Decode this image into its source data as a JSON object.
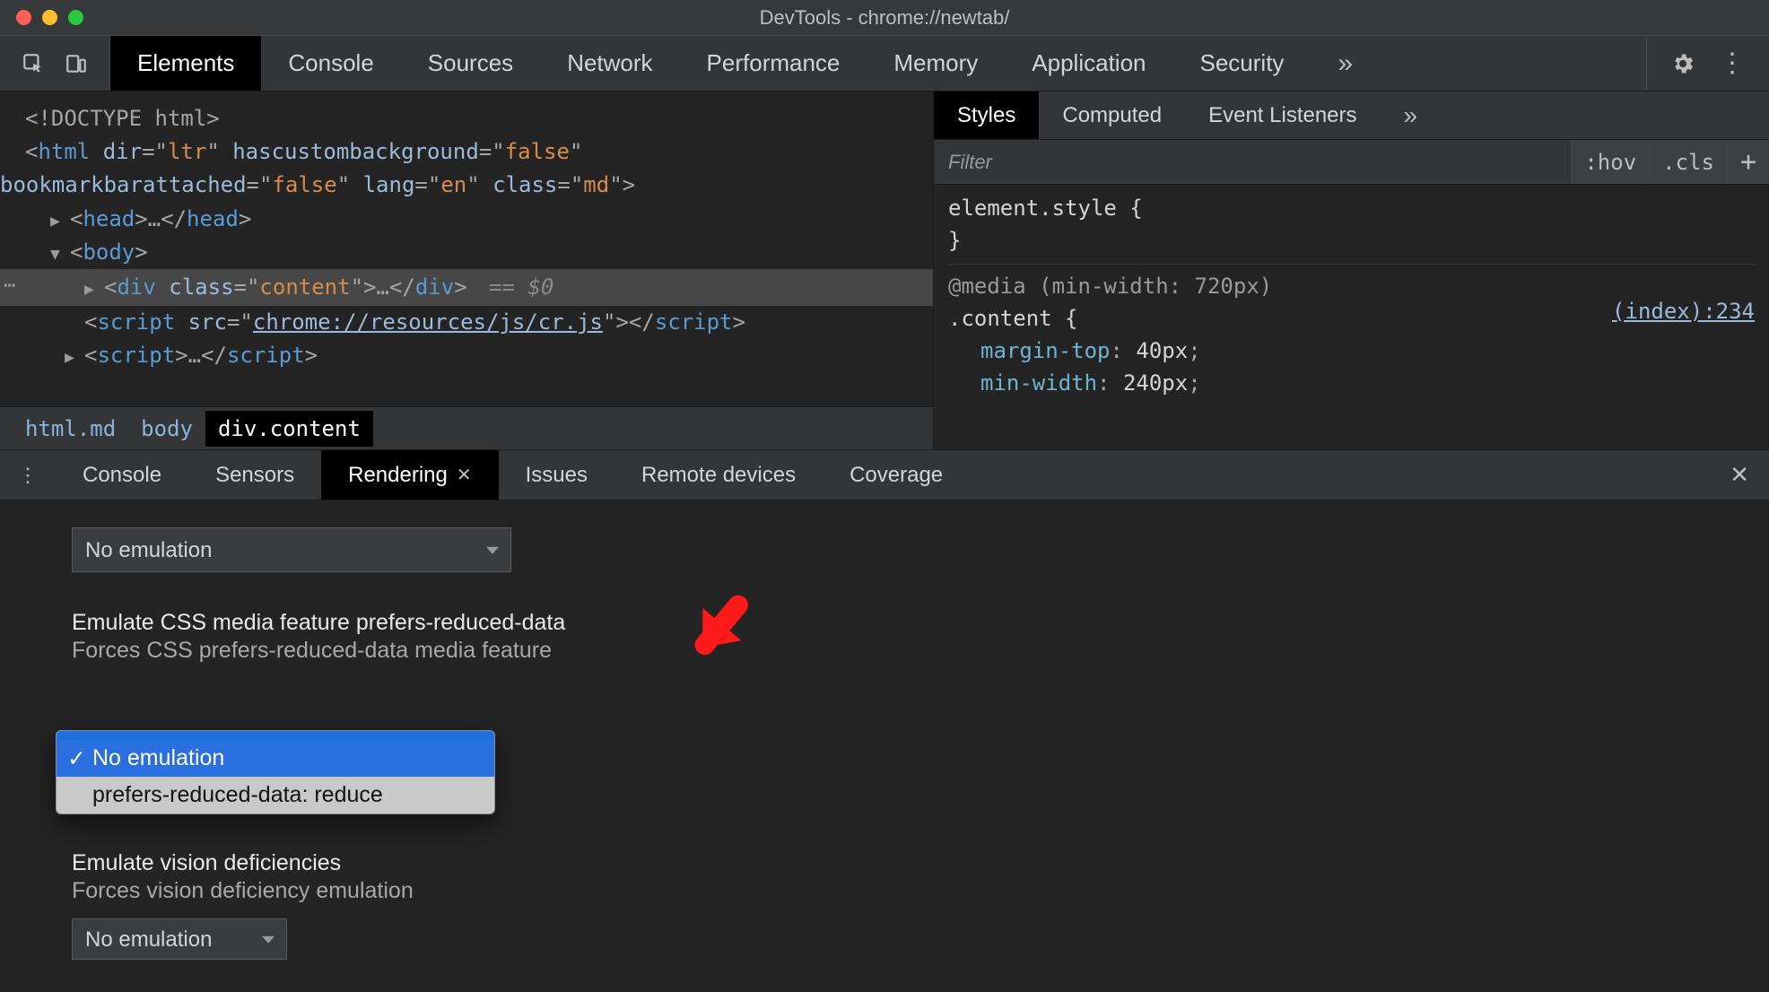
{
  "window": {
    "title": "DevTools - chrome://newtab/"
  },
  "mainTabs": {
    "items": [
      "Elements",
      "Console",
      "Sources",
      "Network",
      "Performance",
      "Memory",
      "Application",
      "Security"
    ],
    "activeIndex": 0
  },
  "dom": {
    "doctype": "<!DOCTYPE html>",
    "htmlOpen": {
      "tag": "html",
      "attrs": [
        [
          "dir",
          "ltr"
        ],
        [
          "hascustombackground",
          "false"
        ],
        [
          "bookmarkbarattached",
          "false"
        ],
        [
          "lang",
          "en"
        ],
        [
          "class",
          "md"
        ]
      ]
    },
    "headCollapsed": "<head>…</head>",
    "bodyOpen": "<body>",
    "selected": {
      "raw": "<div class=\"content\">…</div>",
      "eq": "== $0"
    },
    "scriptCr": {
      "tag": "script",
      "src": "chrome://resources/js/cr.js"
    },
    "scriptCollapsed": "<script>…</scr"
  },
  "breadcrumbs": {
    "items": [
      "html.md",
      "body",
      "div.content"
    ],
    "activeIndex": 2
  },
  "stylesPanel": {
    "tabs": [
      "Styles",
      "Computed",
      "Event Listeners"
    ],
    "activeIndex": 0,
    "filterPlaceholder": "Filter",
    "toolbar": {
      "hov": ":hov",
      "cls": ".cls",
      "plus": "+"
    },
    "elementStyle": {
      "selector": "element.style {",
      "close": "}"
    },
    "mediaRule": {
      "media": "@media (min-width: 720px)",
      "selector": ".content {",
      "link": "(index):234",
      "decls": [
        [
          "margin-top",
          "40px"
        ],
        [
          "min-width",
          "240px"
        ]
      ]
    }
  },
  "drawer": {
    "tabs": [
      "Console",
      "Sensors",
      "Rendering",
      "Issues",
      "Remote devices",
      "Coverage"
    ],
    "activeIndex": 2,
    "topSelect": "No emulation",
    "section1": {
      "title": "Emulate CSS media feature prefers-reduced-data",
      "desc": "Forces CSS prefers-reduced-data media feature",
      "options": [
        "No emulation",
        "prefers-reduced-data: reduce"
      ],
      "selectedIndex": 0
    },
    "section2": {
      "title": "Emulate vision deficiencies",
      "desc": "Forces vision deficiency emulation",
      "select": "No emulation"
    }
  }
}
